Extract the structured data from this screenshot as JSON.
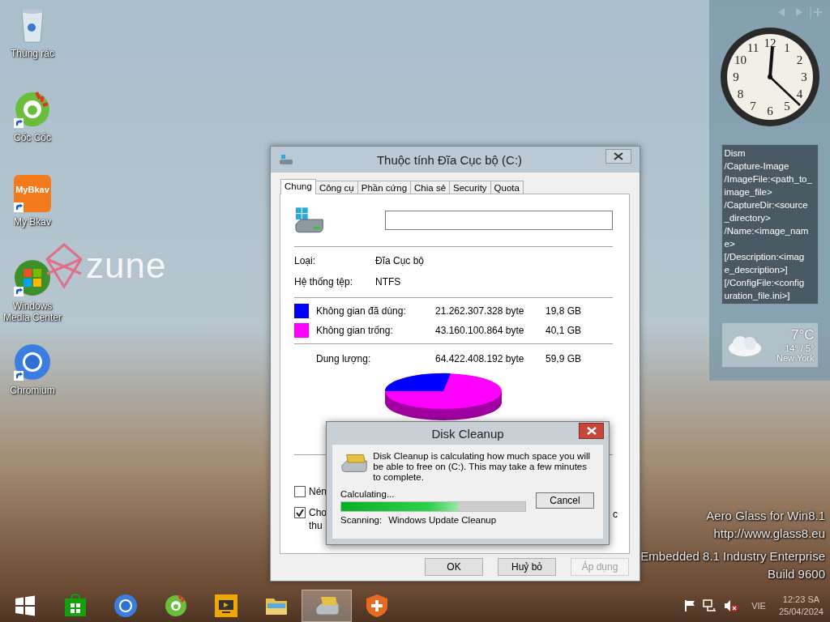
{
  "desktop_icons": [
    {
      "label": "Thùng rác",
      "kind": "bin",
      "shortcut": false
    },
    {
      "label": "Cốc Cốc",
      "kind": "coccoc",
      "shortcut": true
    },
    {
      "label": "My Bkav",
      "kind": "bkav",
      "shortcut": true,
      "icon_text": "MyBkav"
    },
    {
      "label": "Windows Media Center",
      "kind": "mediacenter",
      "shortcut": true
    },
    {
      "label": "Chromium",
      "kind": "chromium",
      "shortcut": true
    }
  ],
  "wallpaper_logo": {
    "text": "zune"
  },
  "desktop_overlay": [
    "Aero Glass for Win8.1",
    "http://www.glass8.eu",
    "Embedded 8.1 Industry Enterprise",
    "Build 9600"
  ],
  "gadgets": {
    "clock": {
      "numerals": [
        "12",
        "11",
        "1",
        "10",
        "2",
        "9",
        "3",
        "8",
        "4",
        "7",
        "5",
        "6"
      ]
    },
    "note": {
      "lines": [
        "Dism",
        "/Capture-Image",
        "/ImageFile:<path_to_",
        "image_file>",
        "/CaptureDir:<source",
        "_directory>",
        "/Name:<image_nam",
        "e>",
        "[/Description:<imag",
        "e_description>]",
        "[/ConfigFile:<config",
        "uration_file.ini>]"
      ]
    },
    "weather": {
      "temperature": "7°C",
      "range": "14° / 5°",
      "city": "New York"
    }
  },
  "properties_window": {
    "title": "Thuộc tính Đĩa Cục bộ (C:)",
    "tabs": [
      {
        "label": "Chung",
        "selected": true
      },
      {
        "label": "Công cụ",
        "selected": false
      },
      {
        "label": "Phần cứng",
        "selected": false
      },
      {
        "label": "Chia sẻ",
        "selected": false
      },
      {
        "label": "Security",
        "selected": false
      },
      {
        "label": "Quota",
        "selected": false
      }
    ],
    "info": [
      {
        "label": "Loại:",
        "value": "Đĩa Cục bộ"
      },
      {
        "label": "Hệ thống tệp:",
        "value": "NTFS"
      }
    ],
    "space": [
      {
        "label": "Không gian đã dùng:",
        "bytes": "21.262.307.328 byte",
        "size": "19,8 GB",
        "color": "#0000ff"
      },
      {
        "label": "Không gian trống:",
        "bytes": "43.160.100.864 byte",
        "size": "40,1 GB",
        "color": "#ff00ff"
      }
    ],
    "capacity": {
      "label": "Dung lượng:",
      "bytes": "64.422.408.192 byte",
      "size": "59,9 GB"
    },
    "checkboxes": [
      {
        "lines": [
          "Nén"
        ],
        "checked": false
      },
      {
        "lines": [
          "Cho",
          "thu"
        ],
        "checked": true
      }
    ],
    "covered_fragment": "c",
    "buttons": [
      {
        "label": "OK",
        "disabled": false
      },
      {
        "label": "Huỷ bỏ",
        "disabled": false
      },
      {
        "label": "Áp dụng",
        "disabled": true
      }
    ]
  },
  "cleanup_dialog": {
    "title": "Disk Cleanup",
    "message": "Disk Cleanup is calculating how much space you will be able to free on  (C:). This may take a few minutes to complete.",
    "status": "Calculating...",
    "progress": {
      "level": 0.64
    },
    "cancel": "Cancel",
    "scanning_label": "Scanning:",
    "scanning_item": "Windows Update Cleanup"
  },
  "taskbar": {
    "apps": [
      {
        "kind": "start",
        "active": false
      },
      {
        "kind": "store",
        "active": false
      },
      {
        "kind": "chromium",
        "active": false
      },
      {
        "kind": "coccoc",
        "active": false
      },
      {
        "kind": "media",
        "active": false
      },
      {
        "kind": "explorer",
        "active": false
      },
      {
        "kind": "cleanup",
        "active": true
      },
      {
        "kind": "shield",
        "active": false
      }
    ],
    "tray": {
      "language": "VIE",
      "time": "12:23 SA",
      "date": "25/04/2024"
    }
  }
}
